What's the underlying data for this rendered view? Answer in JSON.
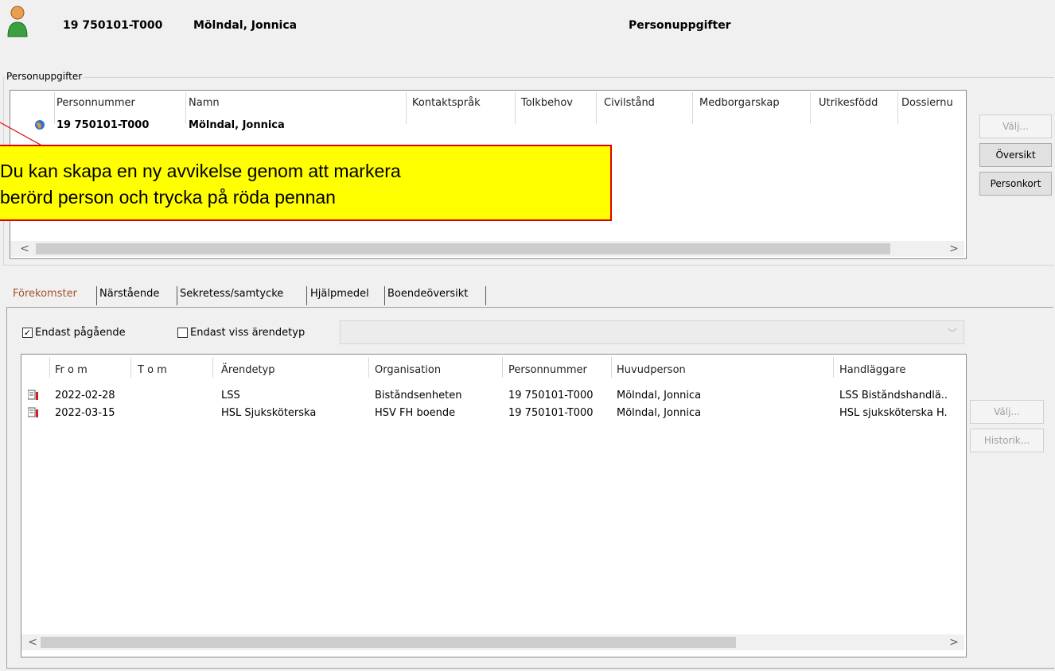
{
  "header": {
    "personnummer": "19 750101-T000",
    "name": "Mölndal, Jonnica",
    "title": "Personuppgifter"
  },
  "person_group": {
    "label": "Personuppgifter",
    "columns": [
      "Personnummer",
      "Namn",
      "Kontaktspråk",
      "Tolkbehov",
      "Civilstånd",
      "Medborgarskap",
      "Utrikesfödd",
      "Dossiernu"
    ],
    "row": {
      "personnummer": "19 750101-T000",
      "name": "Mölndal, Jonnica"
    },
    "buttons": {
      "valj": "Välj...",
      "oversikt": "Översikt",
      "personkort": "Personkort"
    }
  },
  "callout": {
    "line1": "Du kan skapa en ny avvikelse genom att markera",
    "line2": "berörd person och trycka på röda pennan"
  },
  "tabs": [
    "Förekomster",
    "Närstående",
    "Sekretess/samtycke",
    "Hjälpmedel",
    "Boendeöversikt"
  ],
  "filters": {
    "only_ongoing_label": "Endast pågående",
    "only_ongoing_checked": true,
    "case_type_label": "Endast viss ärendetyp",
    "case_type_checked": false
  },
  "cases": {
    "columns": [
      "Fr o m",
      "T o m",
      "Ärendetyp",
      "Organisation",
      "Personnummer",
      "Huvudperson",
      "Handläggare"
    ],
    "rows": [
      {
        "from": "2022-02-28",
        "to": "",
        "type": "LSS",
        "org": "Biståndsenheten",
        "pnr": "19 750101-T000",
        "person": "Mölndal, Jonnica",
        "handler": "LSS Biståndshandlä.."
      },
      {
        "from": "2022-03-15",
        "to": "",
        "type": "HSL Sjuksköterska",
        "org": "HSV FH boende",
        "pnr": "19 750101-T000",
        "person": "Mölndal, Jonnica",
        "handler": "HSL sjuksköterska H."
      }
    ],
    "buttons": {
      "valj": "Välj...",
      "historik": "Historik..."
    }
  },
  "colors": {
    "callout_bg": "#ffff00",
    "callout_border": "#e00000",
    "active_tab": "#a0522d"
  }
}
